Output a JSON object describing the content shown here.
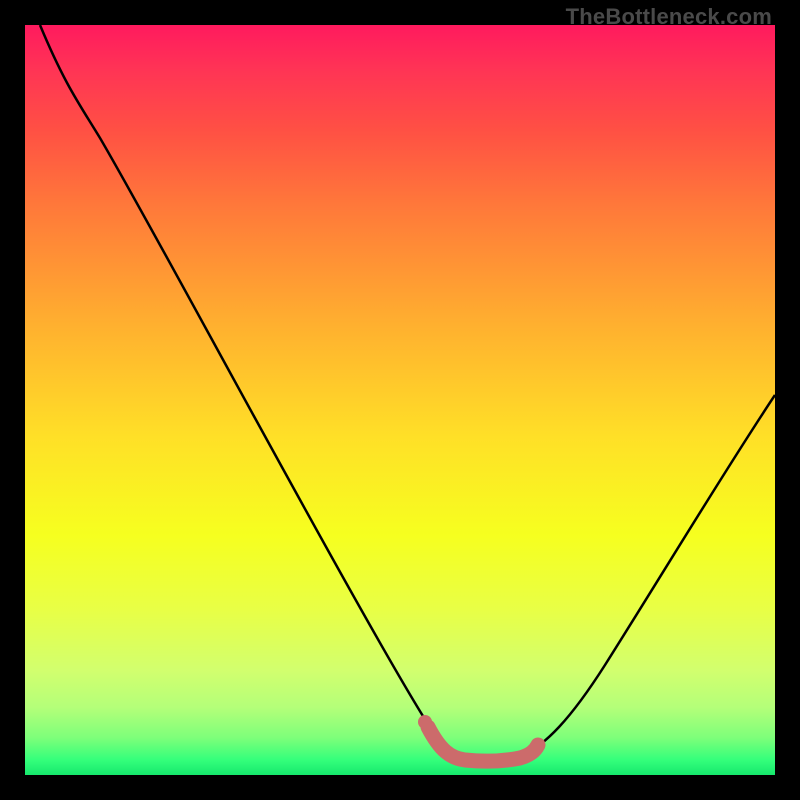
{
  "attribution": "TheBottleneck.com",
  "chart_data": {
    "type": "line",
    "title": "",
    "xlabel": "",
    "ylabel": "",
    "xlim": [
      0,
      100
    ],
    "ylim": [
      0,
      100
    ],
    "series": [
      {
        "name": "curve",
        "x": [
          2,
          5,
          10,
          15,
          20,
          25,
          30,
          35,
          40,
          45,
          50,
          53,
          56,
          60,
          63,
          66,
          70,
          75,
          80,
          85,
          90,
          95,
          100
        ],
        "y": [
          100,
          94,
          85,
          76,
          67,
          57,
          48,
          38,
          29,
          19,
          10,
          5,
          3,
          2,
          2,
          3,
          6,
          12,
          20,
          29,
          38,
          47,
          56
        ]
      }
    ],
    "highlight": {
      "name": "optimal-band",
      "x": [
        53,
        56,
        60,
        63,
        66
      ],
      "y": [
        5,
        3,
        2,
        2,
        3
      ],
      "color": "#cc6b6b"
    }
  }
}
